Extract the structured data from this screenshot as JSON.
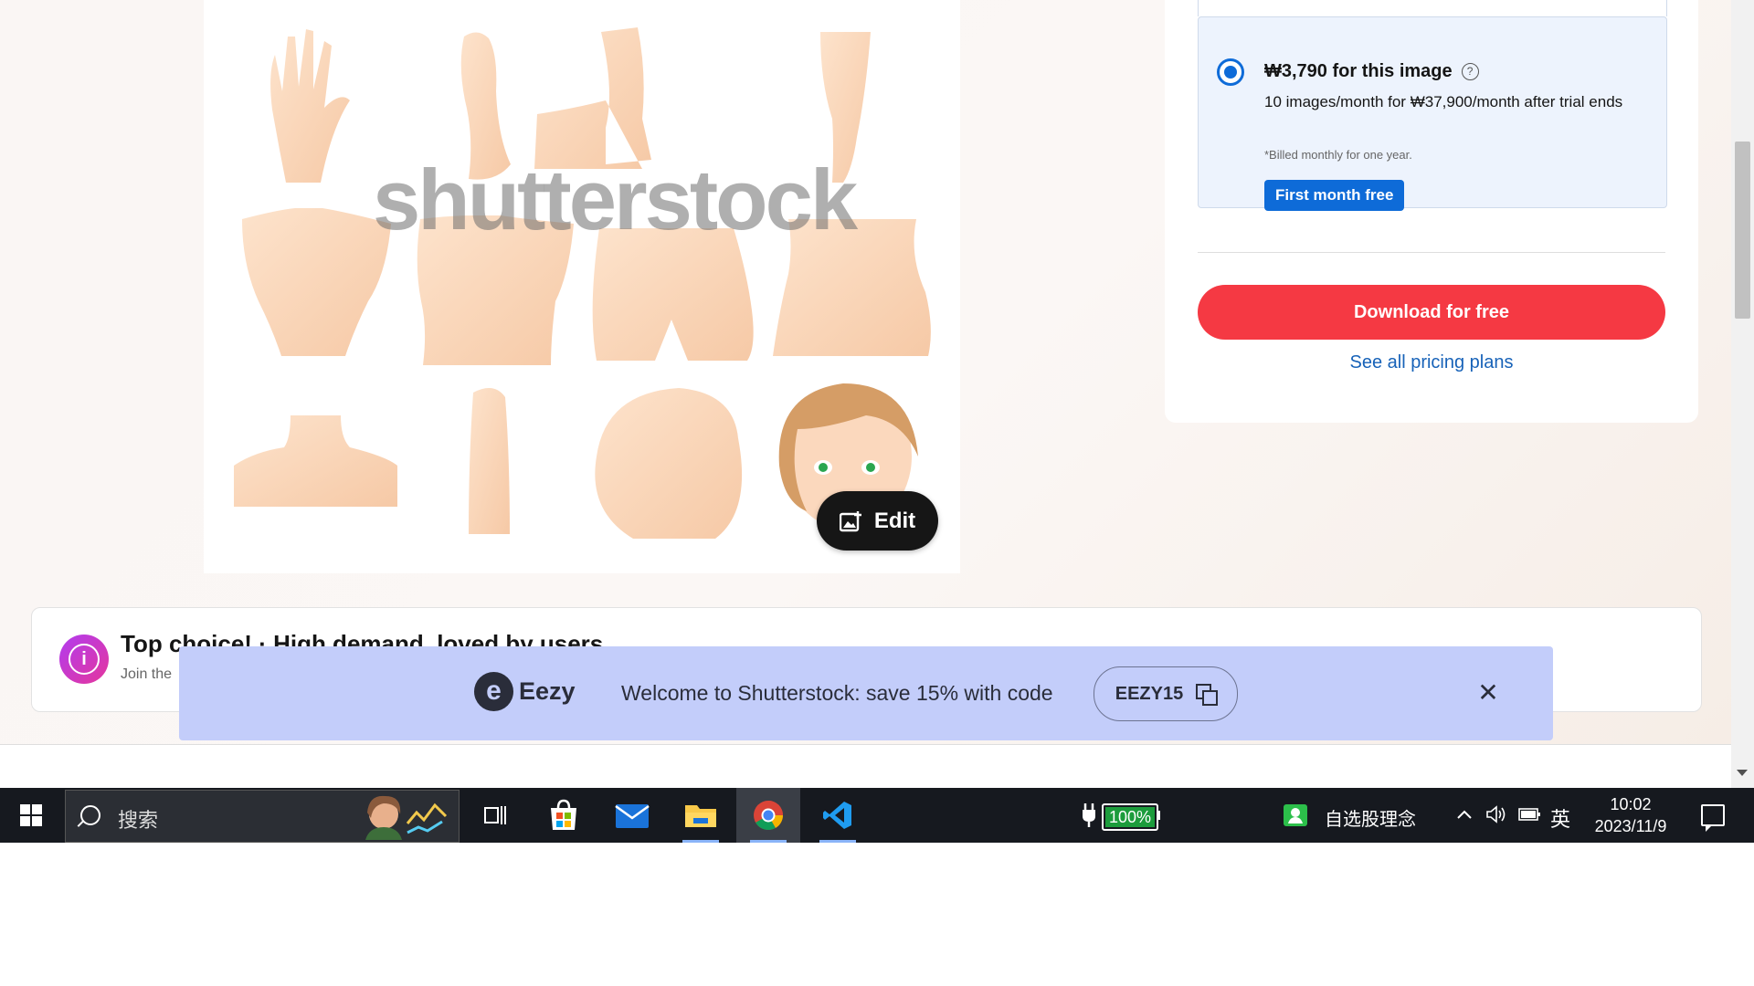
{
  "colors": {
    "accent_blue": "#0e6bd8",
    "download_red": "#f53943",
    "link_blue": "#1762b8",
    "promo_bg": "#c3cdfa",
    "taskbar_bg": "#16191f"
  },
  "preview": {
    "watermark": "shutterstock",
    "edit_label": "Edit",
    "edit_icon": "image-edit-icon"
  },
  "pricing": {
    "plan_price": "₩3,790 for this image",
    "plan_desc": "10 images/month for ₩37,900/month after trial ends",
    "plan_note": "*Billed monthly for one year.",
    "badge": "First month free",
    "download_label": "Download for free",
    "pricing_link": "See all pricing plans"
  },
  "top_choice": {
    "title": "Top choice! · High demand, loved by users",
    "subtitle": "Join the",
    "icon": "info-icon"
  },
  "promo": {
    "brand": "Eezy",
    "message": "Welcome to Shutterstock: save 15% with code",
    "code": "EEZY15"
  },
  "taskbar": {
    "search_placeholder": "搜索",
    "battery": "100%",
    "battery_level": 1.0,
    "stock_app": "自选股理念",
    "ime": "英",
    "time": "10:02",
    "date": "2023/11/9"
  }
}
